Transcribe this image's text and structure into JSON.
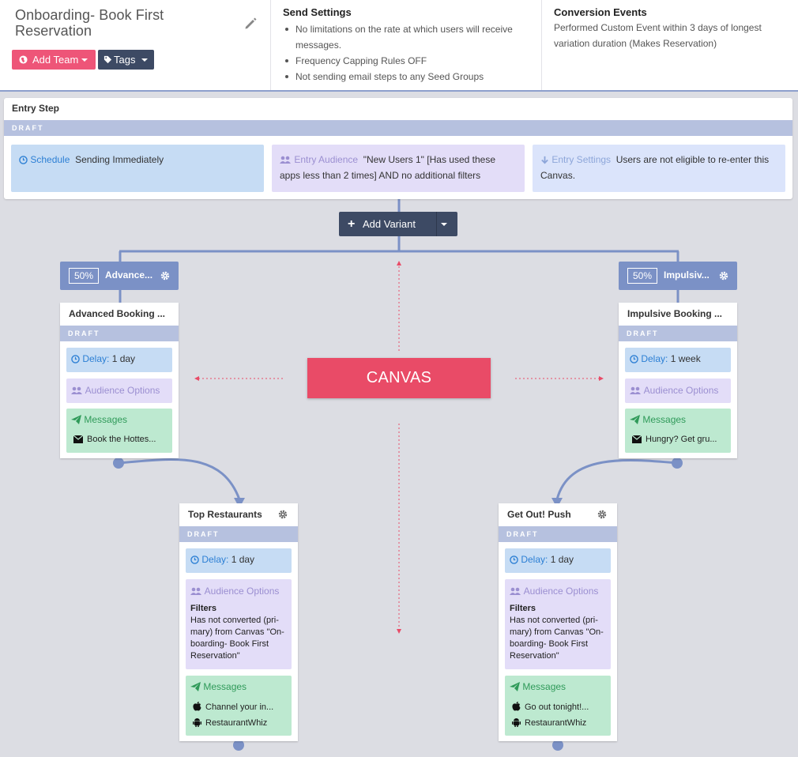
{
  "header": {
    "title": "Onboarding- Book First Reservation",
    "add_team_label": "Add Team",
    "tags_label": "Tags",
    "send_settings": {
      "heading": "Send Settings",
      "items": [
        "No limitations on the rate at which users will receive messages.",
        "Frequency Capping Rules OFF",
        "Not sending email steps to any Seed Groups"
      ]
    },
    "conversion_events": {
      "heading": "Conversion Events",
      "text": "Performed Custom Event within 3 days of longest variation duration (Makes Reservation)"
    }
  },
  "entry_step": {
    "title": "Entry Step",
    "status": "DRAFT",
    "schedule": {
      "label": "Schedule",
      "value": "Sending Immediately"
    },
    "audience": {
      "label": "Entry Audience",
      "value": "\"New Users 1\" [Has used these apps less than 2 times] AND no additional filters"
    },
    "settings": {
      "label": "Entry Settings",
      "value": "Users are not eligible to re-enter this Canvas."
    }
  },
  "add_variant_label": "Add Variant",
  "canvas_label": "CANVAS",
  "variants": [
    {
      "percent": "50%",
      "name": "Advance...",
      "step": {
        "title": "Advanced Booking ...",
        "status": "DRAFT",
        "delay_label": "Delay:",
        "delay_value": "1 day",
        "audience_label": "Audience Options",
        "messages_label": "Messages",
        "messages": [
          "Book the Hottes..."
        ]
      }
    },
    {
      "percent": "50%",
      "name": "Impulsiv...",
      "step": {
        "title": "Impulsive Booking ...",
        "status": "DRAFT",
        "delay_label": "Delay:",
        "delay_value": "1 week",
        "audience_label": "Audience Options",
        "messages_label": "Messages",
        "messages": [
          "Hungry? Get gru..."
        ]
      }
    }
  ],
  "follow_steps": [
    {
      "title": "Top Restaurants",
      "status": "DRAFT",
      "delay_label": "Delay:",
      "delay_value": "1 day",
      "audience_label": "Audience Options",
      "filters_heading": "Filters",
      "filters_text": "Has not converted (pri-mary) from Canvas \"On-boarding- Book First Reservation\"",
      "messages_label": "Messages",
      "messages": [
        "Channel your in...",
        "RestaurantWhiz"
      ]
    },
    {
      "title": "Get Out! Push",
      "status": "DRAFT",
      "delay_label": "Delay:",
      "delay_value": "1 day",
      "audience_label": "Audience Options",
      "filters_heading": "Filters",
      "filters_text": "Has not converted (pri-mary) from Canvas \"On-boarding- Book First Reservation\"",
      "messages_label": "Messages",
      "messages": [
        "Go out tonight!...",
        "RestaurantWhiz"
      ]
    }
  ],
  "colors": {
    "accent_pink": "#ee5578",
    "canvas_red": "#e94b67",
    "navy": "#3d4a64",
    "connector_blue": "#7b91c6",
    "guide_red": "#e94b67"
  },
  "icons": [
    "pencil-icon",
    "globe-icon",
    "tag-icon",
    "clock-icon",
    "users-icon",
    "arrow-down-icon",
    "plus-icon",
    "gear-icon",
    "paper-plane-icon",
    "envelope-icon",
    "apple-icon",
    "android-icon"
  ]
}
